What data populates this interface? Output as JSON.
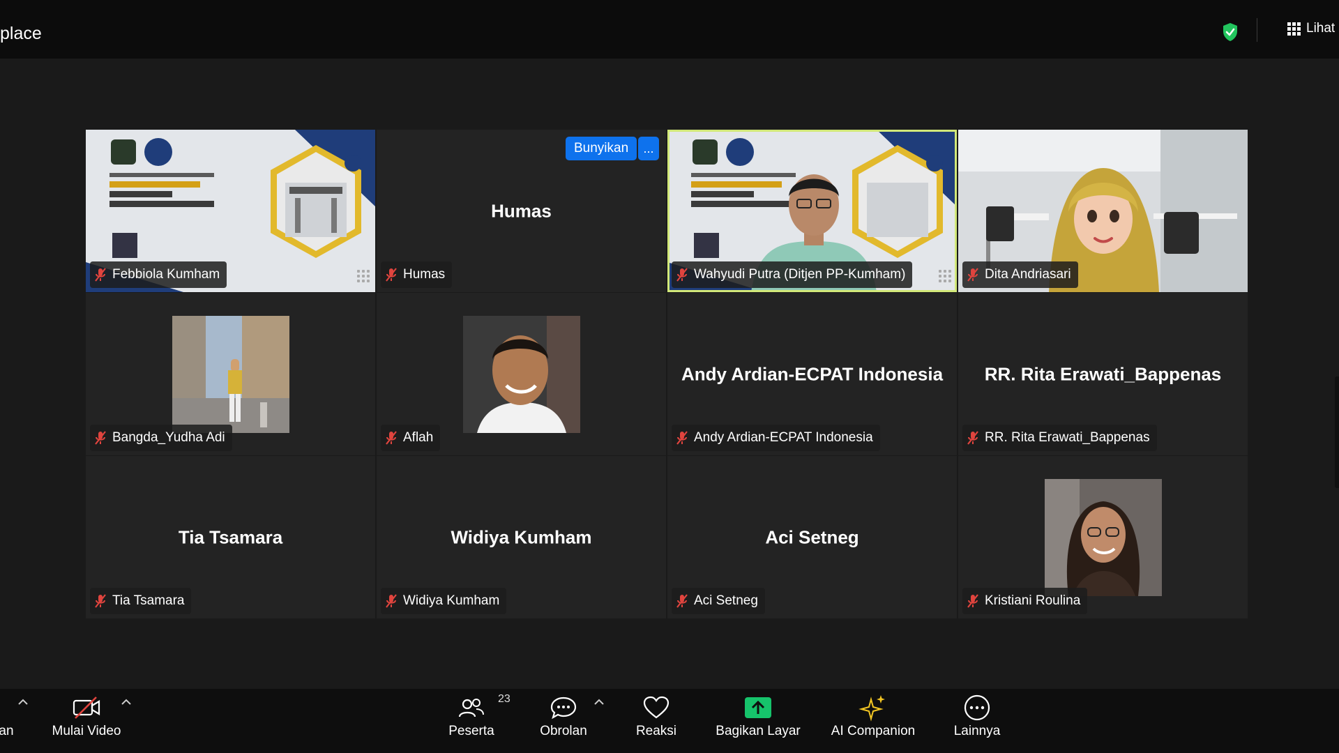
{
  "window": {
    "title": "place",
    "view_label": "Lihat",
    "colors": {
      "accent": "#0e72ed",
      "speaker_border": "#d2e879",
      "shield": "#22c55e",
      "mute": "#e0443e"
    }
  },
  "tiles": {
    "febbiola": {
      "name": "Febbiola Kumham"
    },
    "humas": {
      "display": "Humas",
      "name": "Humas",
      "unmute": "Bunyikan",
      "more": "..."
    },
    "wahyudi": {
      "name": "Wahyudi Putra (Ditjen PP-Kumham)"
    },
    "dita": {
      "name": "Dita Andriasari"
    },
    "bangda": {
      "name": "Bangda_Yudha Adi"
    },
    "aflah": {
      "name": "Aflah"
    },
    "andy": {
      "display": "Andy Ardian-ECPAT Indonesia",
      "name": "Andy Ardian-ECPAT Indonesia"
    },
    "rita": {
      "display": "RR. Rita Erawati_Bappenas",
      "name": "RR. Rita Erawati_Bappenas"
    },
    "tia": {
      "display": "Tia Tsamara",
      "name": "Tia Tsamara"
    },
    "widiya": {
      "display": "Widiya Kumham",
      "name": "Widiya Kumham"
    },
    "aci": {
      "display": "Aci Setneg",
      "name": "Aci Setneg"
    },
    "kristiani": {
      "name": "Kristiani Roulina"
    }
  },
  "toolbar": {
    "audio_label": "an",
    "video_label": "Mulai Video",
    "participants_label": "Peserta",
    "participants_count": "23",
    "chat_label": "Obrolan",
    "reactions_label": "Reaksi",
    "share_label": "Bagikan Layar",
    "ai_label": "AI Companion",
    "more_label": "Lainnya"
  }
}
